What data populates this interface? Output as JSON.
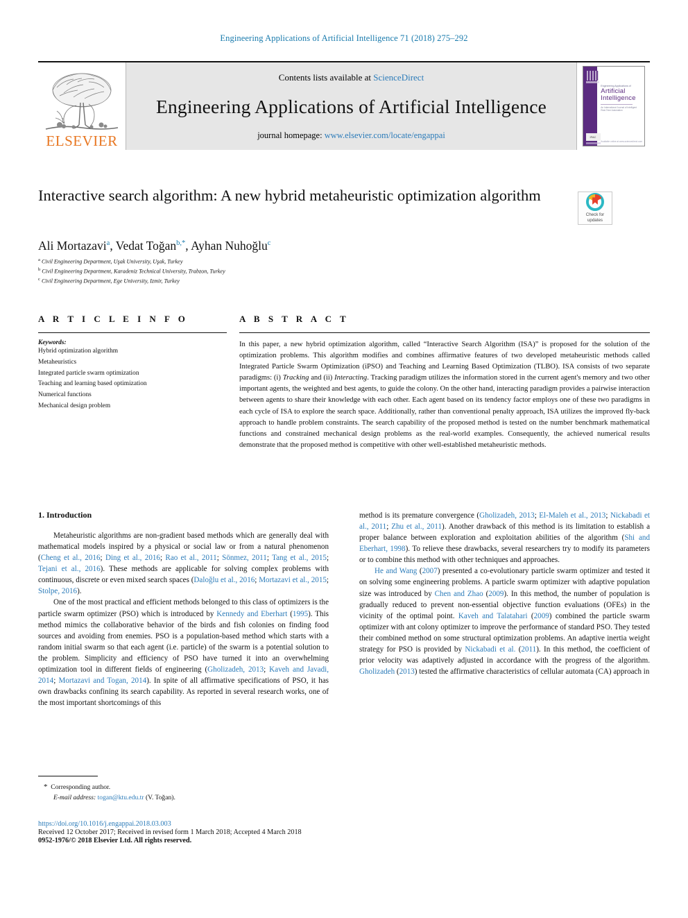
{
  "running_head": "Engineering Applications of Artificial Intelligence 71 (2018) 275–292",
  "masthead": {
    "publisher": "ELSEVIER",
    "contents_prefix": "Contents lists available at ",
    "contents_link": "ScienceDirect",
    "journal_title": "Engineering Applications of Artificial Intelligence",
    "homepage_prefix": "journal homepage: ",
    "homepage_link": "www.elsevier.com/locate/engappai",
    "cover": {
      "eyebrow": "Engineering Applications of",
      "line1": "Artificial",
      "line2": "Intelligence",
      "subtitle": "An International Journal of Intelligent Real-Time Automation",
      "badge": "IFAC",
      "footer": "Available online at www.sciencedirect.com"
    }
  },
  "article": {
    "title": "Interactive search algorithm: A new hybrid metaheuristic optimization algorithm",
    "crossmark_label": "Check for updates",
    "authors": [
      {
        "name": "Ali Mortazavi",
        "sup": "a",
        "sep": ", "
      },
      {
        "name": "Vedat Toğan",
        "sup": "b,*",
        "sep": ", "
      },
      {
        "name": "Ayhan Nuhoğlu",
        "sup": "c",
        "sep": ""
      }
    ],
    "affiliations": [
      {
        "marker": "a",
        "text": "Civil Engineering Department, Uşak University, Uşak, Turkey"
      },
      {
        "marker": "b",
        "text": "Civil Engineering Department, Karadeniz Technical University, Trabzon, Turkey"
      },
      {
        "marker": "c",
        "text": "Civil Engineering Department, Ege University, Izmir, Turkey"
      }
    ]
  },
  "article_info": {
    "heading": "A R T I C L E   I N F O",
    "keywords_label": "Keywords:",
    "keywords": [
      "Hybrid optimization algorithm",
      "Metaheuristics",
      "Integrated particle swarm optimization",
      "Teaching and learning based optimization",
      "Numerical functions",
      "Mechanical design problem"
    ]
  },
  "abstract": {
    "heading": "A B S T R A C T",
    "text_1": "In this paper, a new hybrid optimization algorithm, called “Interactive Search Algorithm (ISA)” is proposed for the solution of the optimization problems. This algorithm modifies and combines affirmative features of two developed metaheuristic methods called Integrated Particle Swarm Optimization (iPSO) and Teaching and Learning Based Optimization (TLBO). ISA consists of two separate paradigms: (i) ",
    "em_1": "Tracking",
    "text_2": " and (ii) ",
    "em_2": "Interacting",
    "text_3": ". Tracking paradigm utilizes the information stored in the current agent's memory and two other important agents, the weighted and best agents, to guide the colony. On the other hand, interacting paradigm provides a pairwise interaction between agents to share their knowledge with each other. Each agent based on its tendency factor employs one of these two paradigms in each cycle of ISA to explore the search space. Additionally, rather than conventional penalty approach, ISA utilizes the improved fly-back approach to handle problem constraints. The search capability of the proposed method is tested on the number benchmark mathematical functions and constrained mechanical design problems as the real-world examples. Consequently, the achieved numerical results demonstrate that the proposed method is competitive with other well-established metaheuristic methods."
  },
  "intro": {
    "section_heading": "1. Introduction",
    "left_paragraphs": [
      {
        "parts": [
          {
            "t": "Metaheuristic algorithms are non-gradient based methods which are generally deal with mathematical models inspired by a physical or social law or from a natural phenomenon ("
          },
          {
            "t": "Cheng et al., 2016",
            "ref": true
          },
          {
            "t": "; "
          },
          {
            "t": "Ding et al., 2016",
            "ref": true
          },
          {
            "t": "; "
          },
          {
            "t": "Rao et al., 2011",
            "ref": true
          },
          {
            "t": "; "
          },
          {
            "t": "Sönmez, 2011",
            "ref": true
          },
          {
            "t": "; "
          },
          {
            "t": "Tang et al., 2015",
            "ref": true
          },
          {
            "t": "; "
          },
          {
            "t": "Tejani et al., 2016",
            "ref": true
          },
          {
            "t": "). These methods are applicable for solving complex problems with continuous, discrete or even mixed search spaces ("
          },
          {
            "t": "Daloğlu et al., 2016",
            "ref": true
          },
          {
            "t": "; "
          },
          {
            "t": "Mortazavi et al., 2015",
            "ref": true
          },
          {
            "t": "; "
          },
          {
            "t": "Stolpe, 2016",
            "ref": true
          },
          {
            "t": ")."
          }
        ]
      },
      {
        "parts": [
          {
            "t": "One of the most practical and efficient methods belonged to this class of optimizers is the particle swarm optimizer (PSO) which is introduced by "
          },
          {
            "t": "Kennedy and Eberhart",
            "ref": true
          },
          {
            "t": " ("
          },
          {
            "t": "1995",
            "ref": true
          },
          {
            "t": "). This method mimics the collaborative behavior of the birds and fish colonies on finding food sources and avoiding from enemies. PSO is a population-based method which starts with a random initial swarm so that each agent (i.e. particle) of the swarm is a potential solution to the problem. Simplicity and efficiency of PSO have turned it into an overwhelming optimization tool in different fields of engineering ("
          },
          {
            "t": "Gholizadeh, 2013",
            "ref": true
          },
          {
            "t": "; "
          },
          {
            "t": "Kaveh and Javadi, 2014",
            "ref": true
          },
          {
            "t": "; "
          },
          {
            "t": "Mortazavi and Togan, 2014",
            "ref": true
          },
          {
            "t": "). In spite of all affirmative specifications of PSO, it has own drawbacks confining its search capability. As reported in several research works, one of the most important shortcomings of this"
          }
        ]
      }
    ],
    "right_paragraphs": [
      {
        "no_indent": true,
        "parts": [
          {
            "t": "method is its premature convergence ("
          },
          {
            "t": "Gholizadeh, 2013",
            "ref": true
          },
          {
            "t": "; "
          },
          {
            "t": "El-Maleh et al., 2013",
            "ref": true
          },
          {
            "t": "; "
          },
          {
            "t": "Nickabadi et al., 2011",
            "ref": true
          },
          {
            "t": "; "
          },
          {
            "t": "Zhu et al., 2011",
            "ref": true
          },
          {
            "t": "). Another drawback of this method is its limitation to establish a proper balance between exploration and exploitation abilities of the algorithm ("
          },
          {
            "t": "Shi and Eberhart, 1998",
            "ref": true
          },
          {
            "t": "). To relieve these drawbacks, several researchers try to modify its parameters or to combine this method with other techniques and approaches."
          }
        ]
      },
      {
        "parts": [
          {
            "t": "He and Wang",
            "ref": true
          },
          {
            "t": " ("
          },
          {
            "t": "2007",
            "ref": true
          },
          {
            "t": ") presented a co-evolutionary particle swarm optimizer and tested it on solving some engineering problems. A particle swarm optimizer with adaptive population size was introduced by "
          },
          {
            "t": "Chen and Zhao",
            "ref": true
          },
          {
            "t": " ("
          },
          {
            "t": "2009",
            "ref": true
          },
          {
            "t": "). In this method, the number of population is gradually reduced to prevent non-essential objective function evaluations (OFEs) in the vicinity of the optimal point. "
          },
          {
            "t": "Kaveh and Talatahari",
            "ref": true
          },
          {
            "t": " ("
          },
          {
            "t": "2009",
            "ref": true
          },
          {
            "t": ") combined the particle swarm optimizer with ant colony optimizer to improve the performance of standard PSO. They tested their combined method on some structural optimization problems. An adaptive inertia weight strategy for PSO is provided by "
          },
          {
            "t": "Nickabadi et al.",
            "ref": true
          },
          {
            "t": " ("
          },
          {
            "t": "2011",
            "ref": true
          },
          {
            "t": "). In this method, the coefficient of prior velocity was adaptively adjusted in accordance with the progress of the algorithm. "
          },
          {
            "t": "Gholizadeh",
            "ref": true
          },
          {
            "t": " ("
          },
          {
            "t": "2013",
            "ref": true
          },
          {
            "t": ") tested the affirmative characteristics of cellular automata (CA) approach in"
          }
        ]
      }
    ]
  },
  "footnote": {
    "star": "*",
    "corresponding": "Corresponding author.",
    "email_label": "E-mail address:",
    "email": "togan@ktu.edu.tr",
    "email_owner": "(V. Toğan)."
  },
  "footer": {
    "doi": "https://doi.org/10.1016/j.engappai.2018.03.003",
    "received": "Received 12 October 2017; Received in revised form 1 March 2018; Accepted 4 March 2018",
    "copyright": "0952-1976/© 2018 Elsevier Ltd. All rights reserved."
  }
}
